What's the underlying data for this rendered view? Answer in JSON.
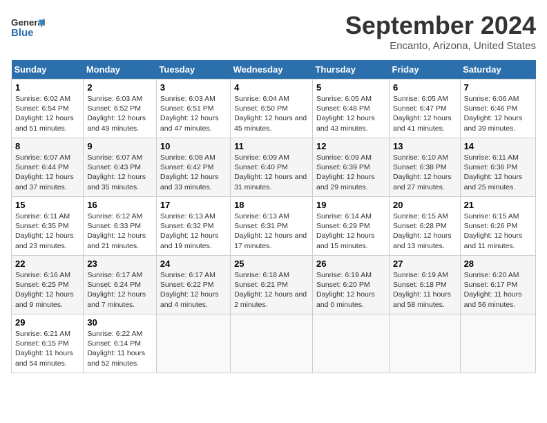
{
  "header": {
    "logo_line1": "General",
    "logo_line2": "Blue",
    "month": "September 2024",
    "location": "Encanto, Arizona, United States"
  },
  "weekdays": [
    "Sunday",
    "Monday",
    "Tuesday",
    "Wednesday",
    "Thursday",
    "Friday",
    "Saturday"
  ],
  "weeks": [
    [
      {
        "day": "1",
        "rise": "6:02 AM",
        "set": "6:54 PM",
        "daylight": "12 hours and 51 minutes."
      },
      {
        "day": "2",
        "rise": "6:03 AM",
        "set": "6:52 PM",
        "daylight": "12 hours and 49 minutes."
      },
      {
        "day": "3",
        "rise": "6:03 AM",
        "set": "6:51 PM",
        "daylight": "12 hours and 47 minutes."
      },
      {
        "day": "4",
        "rise": "6:04 AM",
        "set": "6:50 PM",
        "daylight": "12 hours and 45 minutes."
      },
      {
        "day": "5",
        "rise": "6:05 AM",
        "set": "6:48 PM",
        "daylight": "12 hours and 43 minutes."
      },
      {
        "day": "6",
        "rise": "6:05 AM",
        "set": "6:47 PM",
        "daylight": "12 hours and 41 minutes."
      },
      {
        "day": "7",
        "rise": "6:06 AM",
        "set": "6:46 PM",
        "daylight": "12 hours and 39 minutes."
      }
    ],
    [
      {
        "day": "8",
        "rise": "6:07 AM",
        "set": "6:44 PM",
        "daylight": "12 hours and 37 minutes."
      },
      {
        "day": "9",
        "rise": "6:07 AM",
        "set": "6:43 PM",
        "daylight": "12 hours and 35 minutes."
      },
      {
        "day": "10",
        "rise": "6:08 AM",
        "set": "6:42 PM",
        "daylight": "12 hours and 33 minutes."
      },
      {
        "day": "11",
        "rise": "6:09 AM",
        "set": "6:40 PM",
        "daylight": "12 hours and 31 minutes."
      },
      {
        "day": "12",
        "rise": "6:09 AM",
        "set": "6:39 PM",
        "daylight": "12 hours and 29 minutes."
      },
      {
        "day": "13",
        "rise": "6:10 AM",
        "set": "6:38 PM",
        "daylight": "12 hours and 27 minutes."
      },
      {
        "day": "14",
        "rise": "6:11 AM",
        "set": "6:36 PM",
        "daylight": "12 hours and 25 minutes."
      }
    ],
    [
      {
        "day": "15",
        "rise": "6:11 AM",
        "set": "6:35 PM",
        "daylight": "12 hours and 23 minutes."
      },
      {
        "day": "16",
        "rise": "6:12 AM",
        "set": "6:33 PM",
        "daylight": "12 hours and 21 minutes."
      },
      {
        "day": "17",
        "rise": "6:13 AM",
        "set": "6:32 PM",
        "daylight": "12 hours and 19 minutes."
      },
      {
        "day": "18",
        "rise": "6:13 AM",
        "set": "6:31 PM",
        "daylight": "12 hours and 17 minutes."
      },
      {
        "day": "19",
        "rise": "6:14 AM",
        "set": "6:29 PM",
        "daylight": "12 hours and 15 minutes."
      },
      {
        "day": "20",
        "rise": "6:15 AM",
        "set": "6:28 PM",
        "daylight": "12 hours and 13 minutes."
      },
      {
        "day": "21",
        "rise": "6:15 AM",
        "set": "6:26 PM",
        "daylight": "12 hours and 11 minutes."
      }
    ],
    [
      {
        "day": "22",
        "rise": "6:16 AM",
        "set": "6:25 PM",
        "daylight": "12 hours and 9 minutes."
      },
      {
        "day": "23",
        "rise": "6:17 AM",
        "set": "6:24 PM",
        "daylight": "12 hours and 7 minutes."
      },
      {
        "day": "24",
        "rise": "6:17 AM",
        "set": "6:22 PM",
        "daylight": "12 hours and 4 minutes."
      },
      {
        "day": "25",
        "rise": "6:18 AM",
        "set": "6:21 PM",
        "daylight": "12 hours and 2 minutes."
      },
      {
        "day": "26",
        "rise": "6:19 AM",
        "set": "6:20 PM",
        "daylight": "12 hours and 0 minutes."
      },
      {
        "day": "27",
        "rise": "6:19 AM",
        "set": "6:18 PM",
        "daylight": "11 hours and 58 minutes."
      },
      {
        "day": "28",
        "rise": "6:20 AM",
        "set": "6:17 PM",
        "daylight": "11 hours and 56 minutes."
      }
    ],
    [
      {
        "day": "29",
        "rise": "6:21 AM",
        "set": "6:15 PM",
        "daylight": "11 hours and 54 minutes."
      },
      {
        "day": "30",
        "rise": "6:22 AM",
        "set": "6:14 PM",
        "daylight": "11 hours and 52 minutes."
      },
      null,
      null,
      null,
      null,
      null
    ]
  ]
}
